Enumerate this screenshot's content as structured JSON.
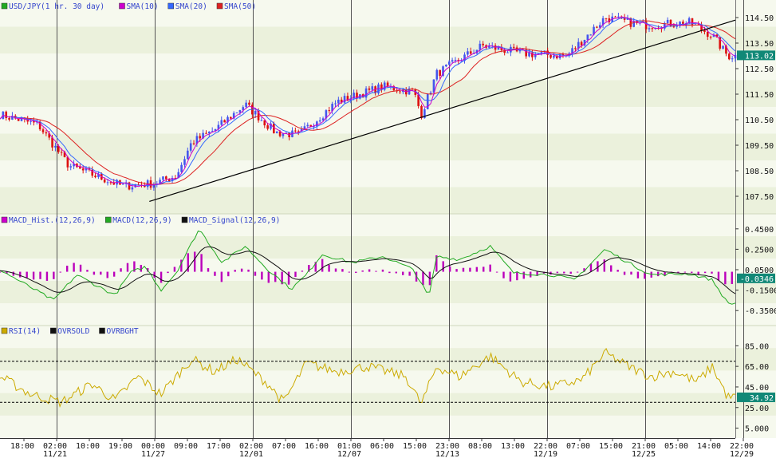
{
  "chart_data": [
    {
      "type": "candlestick",
      "panel": "price",
      "legend": [
        {
          "label": "USD/JPY(1 hr.  30 day)",
          "color": "#22aa22"
        },
        {
          "label": "SMA(10)",
          "color": "#cc00cc"
        },
        {
          "label": "SMA(20)",
          "color": "#3366ff"
        },
        {
          "label": "SMA(50)",
          "color": "#dd2222"
        }
      ],
      "y_ticks": [
        "114.50",
        "113.50",
        "112.50",
        "111.50",
        "110.50",
        "109.50",
        "108.50",
        "107.50"
      ],
      "ylim": [
        107.0,
        115.0
      ],
      "last_value": "113.02",
      "anchors": [
        {
          "t": 0,
          "v": 110.7
        },
        {
          "t": 5,
          "v": 110.3
        },
        {
          "t": 9,
          "v": 108.7
        },
        {
          "t": 16,
          "v": 107.9
        },
        {
          "t": 20,
          "v": 108.0
        },
        {
          "t": 23,
          "v": 108.3
        },
        {
          "t": 25,
          "v": 109.6
        },
        {
          "t": 28,
          "v": 110.1
        },
        {
          "t": 32,
          "v": 111.1
        },
        {
          "t": 36,
          "v": 110.0
        },
        {
          "t": 39,
          "v": 109.9
        },
        {
          "t": 44,
          "v": 111.2
        },
        {
          "t": 50,
          "v": 111.8
        },
        {
          "t": 54,
          "v": 111.6
        },
        {
          "t": 55,
          "v": 110.7
        },
        {
          "t": 57,
          "v": 112.3
        },
        {
          "t": 63,
          "v": 113.4
        },
        {
          "t": 68,
          "v": 113.1
        },
        {
          "t": 74,
          "v": 113.0
        },
        {
          "t": 79,
          "v": 114.5
        },
        {
          "t": 84,
          "v": 114.2
        },
        {
          "t": 90,
          "v": 114.3
        },
        {
          "t": 93,
          "v": 113.8
        },
        {
          "t": 95,
          "v": 113.0
        }
      ],
      "trendline": [
        {
          "t": 19.5,
          "v": 107.3
        },
        {
          "t": 96,
          "v": 114.4
        }
      ]
    },
    {
      "type": "line",
      "panel": "macd",
      "legend": [
        {
          "label": "MACD_Hist.(12,26,9)",
          "color": "#cc00cc"
        },
        {
          "label": "MACD(12,26,9)",
          "color": "#22aa22"
        },
        {
          "label": "MACD_Signal(12,26,9)",
          "color": "#111111"
        }
      ],
      "y_ticks": [
        "0.4500",
        "0.2500",
        "0.0500",
        "-0.1500",
        "-0.3500"
      ],
      "ylim": [
        -0.45,
        0.55
      ],
      "last_value": "-0.0346",
      "anchors": [
        {
          "t": 0,
          "v": 0.05
        },
        {
          "t": 3,
          "v": -0.08
        },
        {
          "t": 7,
          "v": -0.25
        },
        {
          "t": 10,
          "v": 0.0
        },
        {
          "t": 13,
          "v": -0.12
        },
        {
          "t": 15,
          "v": -0.2
        },
        {
          "t": 17,
          "v": 0.02
        },
        {
          "t": 19,
          "v": 0.08
        },
        {
          "t": 21,
          "v": -0.15
        },
        {
          "t": 23,
          "v": 0.02
        },
        {
          "t": 26,
          "v": 0.45
        },
        {
          "t": 29,
          "v": 0.12
        },
        {
          "t": 32,
          "v": 0.28
        },
        {
          "t": 35,
          "v": 0.05
        },
        {
          "t": 38,
          "v": -0.14
        },
        {
          "t": 40,
          "v": 0.0
        },
        {
          "t": 42,
          "v": 0.2
        },
        {
          "t": 46,
          "v": 0.12
        },
        {
          "t": 50,
          "v": 0.18
        },
        {
          "t": 54,
          "v": 0.05
        },
        {
          "t": 56,
          "v": -0.22
        },
        {
          "t": 57,
          "v": 0.18
        },
        {
          "t": 60,
          "v": 0.15
        },
        {
          "t": 64,
          "v": 0.28
        },
        {
          "t": 67,
          "v": 0.02
        },
        {
          "t": 72,
          "v": 0.0
        },
        {
          "t": 75,
          "v": -0.05
        },
        {
          "t": 79,
          "v": 0.25
        },
        {
          "t": 82,
          "v": 0.12
        },
        {
          "t": 85,
          "v": 0.0
        },
        {
          "t": 90,
          "v": 0.01
        },
        {
          "t": 93,
          "v": -0.05
        },
        {
          "t": 95,
          "v": -0.28
        }
      ]
    },
    {
      "type": "line",
      "panel": "rsi",
      "legend": [
        {
          "label": "RSI(14)",
          "color": "#ccaa00"
        },
        {
          "label": "OVRSOLD",
          "color": "#111111"
        },
        {
          "label": "OVRBGHT",
          "color": "#111111"
        }
      ],
      "y_ticks": [
        "85.00",
        "65.00",
        "45.00",
        "25.00",
        "5.000"
      ],
      "ylim": [
        0,
        100
      ],
      "overbought": 70,
      "oversold": 30,
      "last_value": "34.92",
      "anchors": [
        {
          "t": 0,
          "v": 55
        },
        {
          "t": 4,
          "v": 38
        },
        {
          "t": 8,
          "v": 30
        },
        {
          "t": 12,
          "v": 48
        },
        {
          "t": 15,
          "v": 32
        },
        {
          "t": 18,
          "v": 55
        },
        {
          "t": 21,
          "v": 38
        },
        {
          "t": 25,
          "v": 72
        },
        {
          "t": 28,
          "v": 60
        },
        {
          "t": 31,
          "v": 72
        },
        {
          "t": 35,
          "v": 48
        },
        {
          "t": 37,
          "v": 30
        },
        {
          "t": 40,
          "v": 68
        },
        {
          "t": 44,
          "v": 60
        },
        {
          "t": 48,
          "v": 65
        },
        {
          "t": 53,
          "v": 55
        },
        {
          "t": 55,
          "v": 28
        },
        {
          "t": 57,
          "v": 65
        },
        {
          "t": 60,
          "v": 55
        },
        {
          "t": 64,
          "v": 75
        },
        {
          "t": 68,
          "v": 50
        },
        {
          "t": 72,
          "v": 45
        },
        {
          "t": 76,
          "v": 52
        },
        {
          "t": 79,
          "v": 78
        },
        {
          "t": 82,
          "v": 65
        },
        {
          "t": 85,
          "v": 55
        },
        {
          "t": 88,
          "v": 60
        },
        {
          "t": 91,
          "v": 50
        },
        {
          "t": 93,
          "v": 65
        },
        {
          "t": 95,
          "v": 35
        }
      ]
    }
  ],
  "x_axis": {
    "ticks": [
      "18:00",
      "02:00",
      "10:00",
      "19:00",
      "00:00",
      "09:00",
      "17:00",
      "02:00",
      "07:00",
      "16:00",
      "01:00",
      "06:00",
      "15:00",
      "23:00",
      "08:00",
      "13:00",
      "22:00",
      "07:00",
      "15:00",
      "21:00",
      "05:00",
      "14:00",
      "22:00"
    ],
    "dates": [
      {
        "tick": 1,
        "label": "11/21"
      },
      {
        "tick": 4,
        "label": "11/27"
      },
      {
        "tick": 7,
        "label": "12/01"
      },
      {
        "tick": 10,
        "label": "12/07"
      },
      {
        "tick": 13,
        "label": "12/13"
      },
      {
        "tick": 16,
        "label": "12/19"
      },
      {
        "tick": 19,
        "label": "12/25"
      },
      {
        "tick": 22,
        "label": "12/29"
      }
    ],
    "separators": [
      1,
      4,
      7,
      10,
      13,
      16,
      19,
      22
    ]
  },
  "colors": {
    "background": "#ffffff",
    "band_light": "#f6f9ee",
    "band_dark": "#ebf1dc",
    "separator": "#555555",
    "tick_text": "#111111",
    "legend_text": "#3344cc",
    "candle_up": "#4455ee",
    "candle_down": "#dd1111",
    "sma10": "#cc00cc",
    "sma20": "#3366ff",
    "sma50": "#dd2222",
    "macd_hist": "#bb00bb",
    "macd_line": "#22aa22",
    "macd_signal": "#111111",
    "rsi_line": "#ccaa00",
    "last_badge": "#118877",
    "trendline": "#000000"
  }
}
